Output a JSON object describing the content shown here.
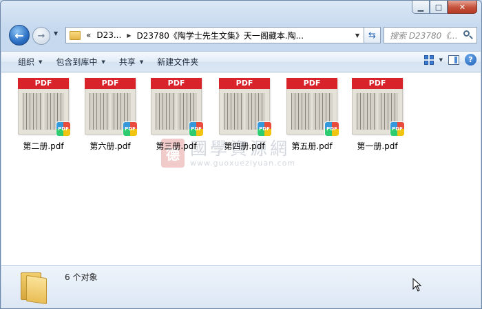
{
  "window": {
    "caption_minimize": "▁",
    "caption_maximize": "□",
    "caption_close": "✕"
  },
  "nav": {
    "back_glyph": "←",
    "forward_glyph": "→",
    "history_dropdown": "▼"
  },
  "address": {
    "overflow": "«",
    "crumbs": [
      "D23...",
      "D23780《陶学士先生文集》天一阁藏本.陶..."
    ],
    "separator": "▶",
    "dropdown": "▼",
    "refresh_glyph": "⇆"
  },
  "search": {
    "placeholder": "搜索 D23780《..."
  },
  "toolbar": {
    "organize": "组织",
    "include_library": "包含到库中",
    "share": "共享",
    "new_folder": "新建文件夹",
    "dropdown_arrow": "▼",
    "help": "?"
  },
  "files": [
    {
      "name": "第二册.pdf",
      "band": "PDF",
      "badge": "PDF"
    },
    {
      "name": "第六册.pdf",
      "band": "PDF",
      "badge": "PDF"
    },
    {
      "name": "第三册.pdf",
      "band": "PDF",
      "badge": "PDF"
    },
    {
      "name": "第四册.pdf",
      "band": "PDF",
      "badge": "PDF"
    },
    {
      "name": "第五册.pdf",
      "band": "PDF",
      "badge": "PDF"
    },
    {
      "name": "第一册.pdf",
      "band": "PDF",
      "badge": "PDF"
    }
  ],
  "watermark": {
    "seal": "德",
    "text": "國學資源網",
    "url": "www.guoxueziyuan.com"
  },
  "status": {
    "count_text": "6 个对象"
  },
  "colors": {
    "pdf_band": "#d8232a",
    "accent": "#2a6fc4"
  }
}
